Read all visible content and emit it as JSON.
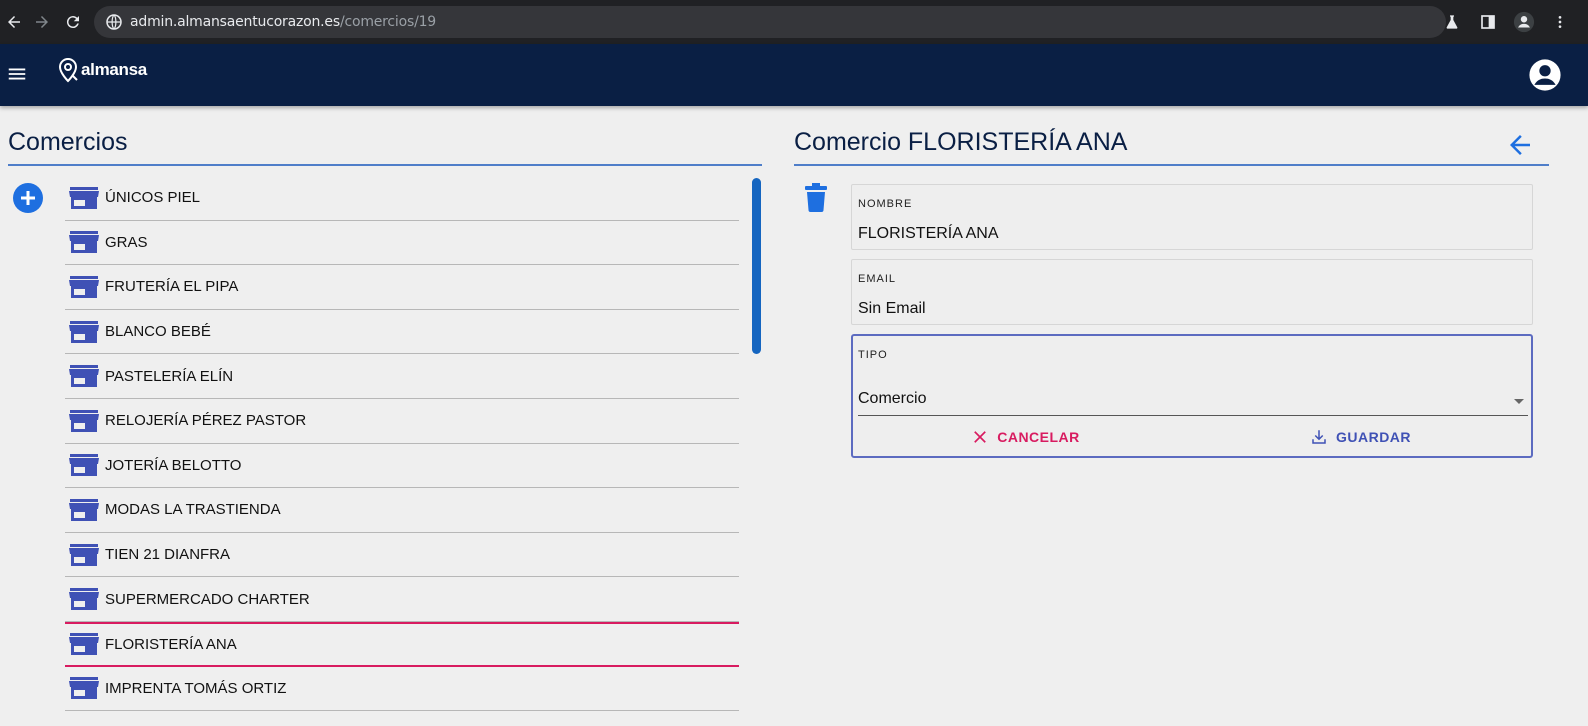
{
  "browser": {
    "url_host": "admin.almansaentucorazon.es",
    "url_path": "/comercios/19"
  },
  "app": {
    "logo_text": "almansa"
  },
  "list_panel": {
    "title": "Comercios",
    "items": [
      {
        "label": "ÚNICOS PIEL"
      },
      {
        "label": "GRAS"
      },
      {
        "label": "FRUTERÍA EL PIPA"
      },
      {
        "label": "BLANCO BEBÉ"
      },
      {
        "label": "PASTELERÍA ELÍN"
      },
      {
        "label": "RELOJERÍA PÉREZ PASTOR"
      },
      {
        "label": "JOTERÍA BELOTTO"
      },
      {
        "label": "MODAS LA TRASTIENDA"
      },
      {
        "label": "TIEN 21 DIANFRA"
      },
      {
        "label": "SUPERMERCADO CHARTER"
      },
      {
        "label": "FLORISTERÍA ANA"
      },
      {
        "label": "IMPRENTA TOMÁS ORTIZ"
      }
    ],
    "selected_label": "FLORISTERÍA ANA"
  },
  "detail_panel": {
    "title": "Comercio FLORISTERÍA ANA",
    "nombre": {
      "label": "NOMBRE",
      "value": "FLORISTERÍA ANA"
    },
    "email": {
      "label": "EMAIL",
      "value": "Sin Email"
    },
    "tipo": {
      "label": "TIPO",
      "value": "Comercio"
    },
    "cancel_label": "CANCELAR",
    "save_label": "GUARDAR"
  },
  "colors": {
    "appbar": "#0a1f44",
    "accent": "#1565c0",
    "store_icon": "#3f51b5",
    "selected": "#d81b60"
  }
}
